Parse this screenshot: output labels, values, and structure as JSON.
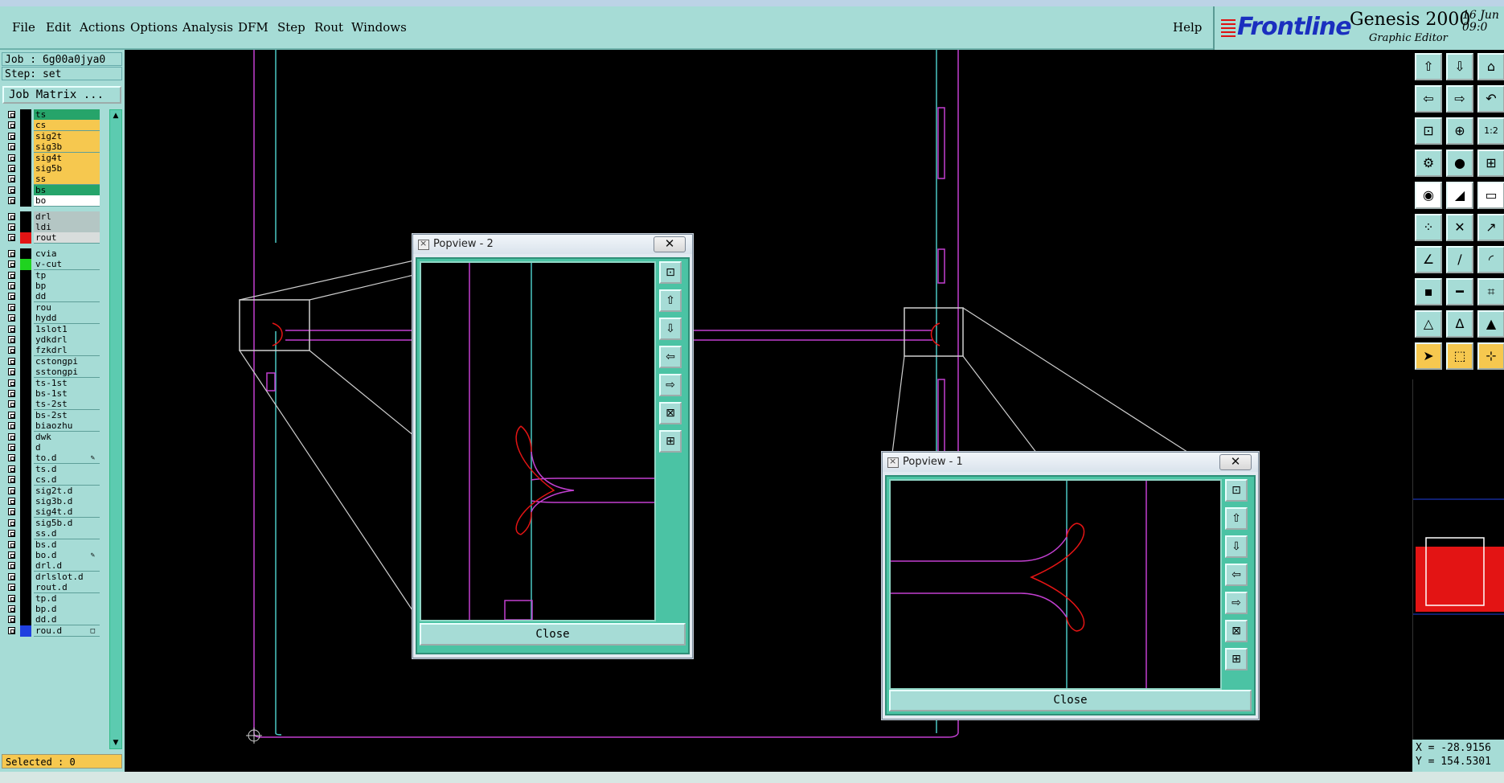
{
  "menu": {
    "file": "File",
    "edit": "Edit",
    "actions": "Actions",
    "options": "Options",
    "analysis": "Analysis",
    "dfm": "DFM",
    "step": "Step",
    "rout": "Rout",
    "windows": "Windows",
    "help": "Help"
  },
  "brand": {
    "logo": "Frontline",
    "product": "Genesis 2000",
    "subtitle": "Graphic Editor",
    "date": "16 Jun\n09:0"
  },
  "job": {
    "job_label": "Job : 6g00a0jya0",
    "step_label": "Step: set",
    "matrix_button": "Job Matrix ..."
  },
  "layers": [
    {
      "name": "ts",
      "color": "#26a46a",
      "swatch": "#000000"
    },
    {
      "name": "cs",
      "color": "#f6c84f",
      "swatch": "#000000"
    },
    {
      "name": "sig2t",
      "color": "#f6c84f",
      "swatch": "#000000"
    },
    {
      "name": "sig3b",
      "color": "#f6c84f",
      "swatch": "#000000"
    },
    {
      "name": "sig4t",
      "color": "#f6c84f",
      "swatch": "#000000"
    },
    {
      "name": "sig5b",
      "color": "#f6c84f",
      "swatch": "#000000"
    },
    {
      "name": "ss",
      "color": "#f6c84f",
      "swatch": "#000000"
    },
    {
      "name": "bs",
      "color": "#26a46a",
      "swatch": "#000000"
    },
    {
      "name": "bo",
      "color": "#ffffff",
      "swatch": "#000000"
    },
    {
      "name": "drl",
      "color": "#b4c6c4",
      "swatch": "#000000"
    },
    {
      "name": "ldi",
      "color": "#b4c6c4",
      "swatch": "#000000"
    },
    {
      "name": "rout",
      "color": "#d8dddc",
      "swatch": "#e31414"
    },
    {
      "name": "cvia",
      "color": "#a6dcd6",
      "swatch": "#000000"
    },
    {
      "name": "v-cut",
      "color": "#a6dcd6",
      "swatch": "#1fd31f"
    },
    {
      "name": "tp",
      "color": "#a6dcd6",
      "swatch": "#000000"
    },
    {
      "name": "bp",
      "color": "#a6dcd6",
      "swatch": "#000000"
    },
    {
      "name": "dd",
      "color": "#a6dcd6",
      "swatch": "#000000"
    },
    {
      "name": "rou",
      "color": "#a6dcd6",
      "swatch": "#000000"
    },
    {
      "name": "hydd",
      "color": "#a6dcd6",
      "swatch": "#000000"
    },
    {
      "name": "1slot1",
      "color": "#a6dcd6",
      "swatch": "#000000"
    },
    {
      "name": "ydkdrl",
      "color": "#a6dcd6",
      "swatch": "#000000"
    },
    {
      "name": "fzkdrl",
      "color": "#a6dcd6",
      "swatch": "#000000"
    },
    {
      "name": "cstongpi",
      "color": "#a6dcd6",
      "swatch": "#000000"
    },
    {
      "name": "sstongpi",
      "color": "#a6dcd6",
      "swatch": "#000000"
    },
    {
      "name": "ts-1st",
      "color": "#a6dcd6",
      "swatch": "#000000"
    },
    {
      "name": "bs-1st",
      "color": "#a6dcd6",
      "swatch": "#000000"
    },
    {
      "name": "ts-2st",
      "color": "#a6dcd6",
      "swatch": "#000000"
    },
    {
      "name": "bs-2st",
      "color": "#a6dcd6",
      "swatch": "#000000"
    },
    {
      "name": "biaozhu",
      "color": "#a6dcd6",
      "swatch": "#000000"
    },
    {
      "name": "dwk",
      "color": "#a6dcd6",
      "swatch": "#000000"
    },
    {
      "name": "d",
      "color": "#a6dcd6",
      "swatch": "#000000"
    },
    {
      "name": "to.d",
      "color": "#a6dcd6",
      "swatch": "#000000",
      "mark": "✎"
    },
    {
      "name": "ts.d",
      "color": "#a6dcd6",
      "swatch": "#000000"
    },
    {
      "name": "cs.d",
      "color": "#a6dcd6",
      "swatch": "#000000"
    },
    {
      "name": "sig2t.d",
      "color": "#a6dcd6",
      "swatch": "#000000"
    },
    {
      "name": "sig3b.d",
      "color": "#a6dcd6",
      "swatch": "#000000"
    },
    {
      "name": "sig4t.d",
      "color": "#a6dcd6",
      "swatch": "#000000"
    },
    {
      "name": "sig5b.d",
      "color": "#a6dcd6",
      "swatch": "#000000"
    },
    {
      "name": "ss.d",
      "color": "#a6dcd6",
      "swatch": "#000000"
    },
    {
      "name": "bs.d",
      "color": "#a6dcd6",
      "swatch": "#000000"
    },
    {
      "name": "bo.d",
      "color": "#a6dcd6",
      "swatch": "#000000",
      "mark": "✎"
    },
    {
      "name": "drl.d",
      "color": "#a6dcd6",
      "swatch": "#000000"
    },
    {
      "name": "drlslot.d",
      "color": "#a6dcd6",
      "swatch": "#000000"
    },
    {
      "name": "rout.d",
      "color": "#a6dcd6",
      "swatch": "#000000"
    },
    {
      "name": "tp.d",
      "color": "#a6dcd6",
      "swatch": "#000000"
    },
    {
      "name": "bp.d",
      "color": "#a6dcd6",
      "swatch": "#000000"
    },
    {
      "name": "dd.d",
      "color": "#a6dcd6",
      "swatch": "#000000"
    },
    {
      "name": "rou.d",
      "color": "#a6dcd6",
      "swatch": "#1f3fe0",
      "mark": "□"
    }
  ],
  "selected": "Selected : 0",
  "popview2": {
    "title": "Popview - 2",
    "close_label": "Close"
  },
  "popview1": {
    "title": "Popview - 1",
    "close_label": "Close"
  },
  "coords": {
    "x": "X = -28.9156",
    "y": "Y = 154.5301"
  },
  "colors": {
    "panel": "#a6dcd6",
    "rout": "#e31414",
    "magenta_trace": "#c23fd0",
    "cyan_trace": "#4bc7c4",
    "outline": "#cfcfcf"
  },
  "icons": {
    "toolbar": [
      "move-up-icon",
      "move-down-icon",
      "home-icon",
      "move-left-icon",
      "move-right-icon",
      "undo-icon",
      "zoom-fit-icon",
      "zoom-center-icon",
      "ratio-icon",
      "measure-icon",
      "pad-icon",
      "route-icon",
      "snap-icon",
      "select-red-icon",
      "ruler-icon",
      "node-icon",
      "cross-icon",
      "link-icon",
      "line-red-icon",
      "line-blue-icon",
      "arc-icon",
      "point-icon",
      "hline-icon",
      "grid-icon",
      "triangle-icon",
      "triangle-a-icon",
      "triangle-b-icon",
      "pointer-icon",
      "pointer-box-icon",
      "pointer-plus-icon"
    ]
  }
}
